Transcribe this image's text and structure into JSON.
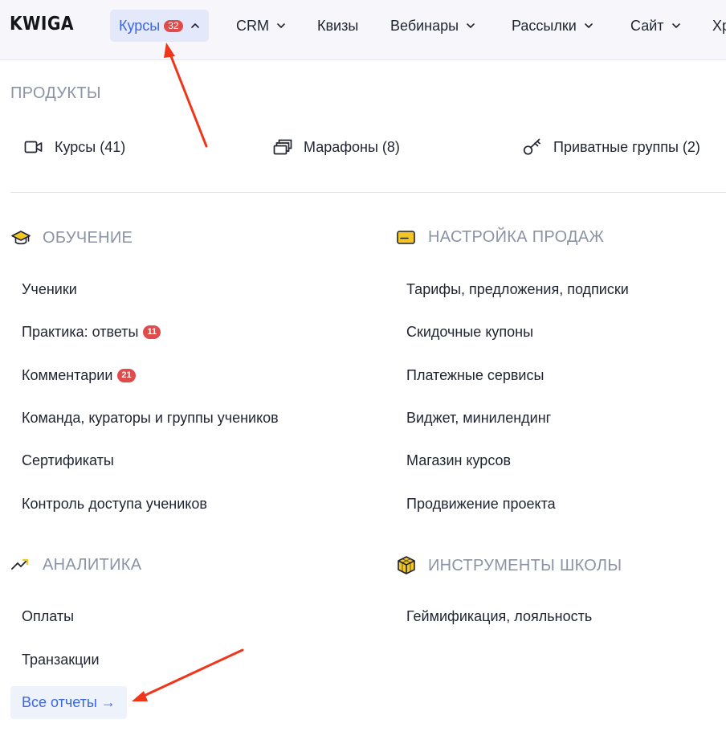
{
  "logo": "KWIGA",
  "nav": {
    "courses": {
      "label": "Курсы",
      "badge": "32"
    },
    "crm": "CRM",
    "quizzes": "Квизы",
    "webinars": "Вебинары",
    "mailings": "Рассылки",
    "site": "Сайт",
    "more": "Хр"
  },
  "products": {
    "title": "ПРОДУКТЫ",
    "items": [
      "Курсы (41)",
      "Марафоны (8)",
      "Приватные группы (2)"
    ]
  },
  "learning": {
    "title": "ОБУЧЕНИЕ",
    "items": [
      {
        "label": "Ученики"
      },
      {
        "label": "Практика: ответы",
        "badge": "11"
      },
      {
        "label": "Комментарии",
        "badge": "21"
      },
      {
        "label": "Команда, кураторы и группы учеников"
      },
      {
        "label": "Сертификаты"
      },
      {
        "label": "Контроль доступа учеников"
      }
    ]
  },
  "sales": {
    "title": "НАСТРОЙКА ПРОДАЖ",
    "items": [
      "Тарифы, предложения, подписки",
      "Скидочные купоны",
      "Платежные сервисы",
      "Виджет, минилендинг",
      "Магазин курсов",
      "Продвижение проекта"
    ]
  },
  "analytics": {
    "title": "АНАЛИТИКА",
    "items": [
      "Оплаты",
      "Транзакции"
    ],
    "all_reports": "Все отчеты →"
  },
  "tools": {
    "title": "ИНСТРУМЕНТЫ ШКОЛЫ",
    "items": [
      "Геймификация, лояльность"
    ]
  },
  "colors": {
    "accent": "#3b66e0",
    "badge": "#e04b4b",
    "icon_yellow": "#f3c623",
    "annotation_arrow": "#f0361a"
  },
  "icons": {
    "products": [
      "video-camera-icon",
      "layers-icon",
      "key-icon"
    ],
    "learning": "graduation-cap-icon",
    "sales": "credit-card-icon",
    "analytics": "trending-up-icon",
    "tools": "cube-icon",
    "nav_chevron": "chevron-down-icon"
  }
}
